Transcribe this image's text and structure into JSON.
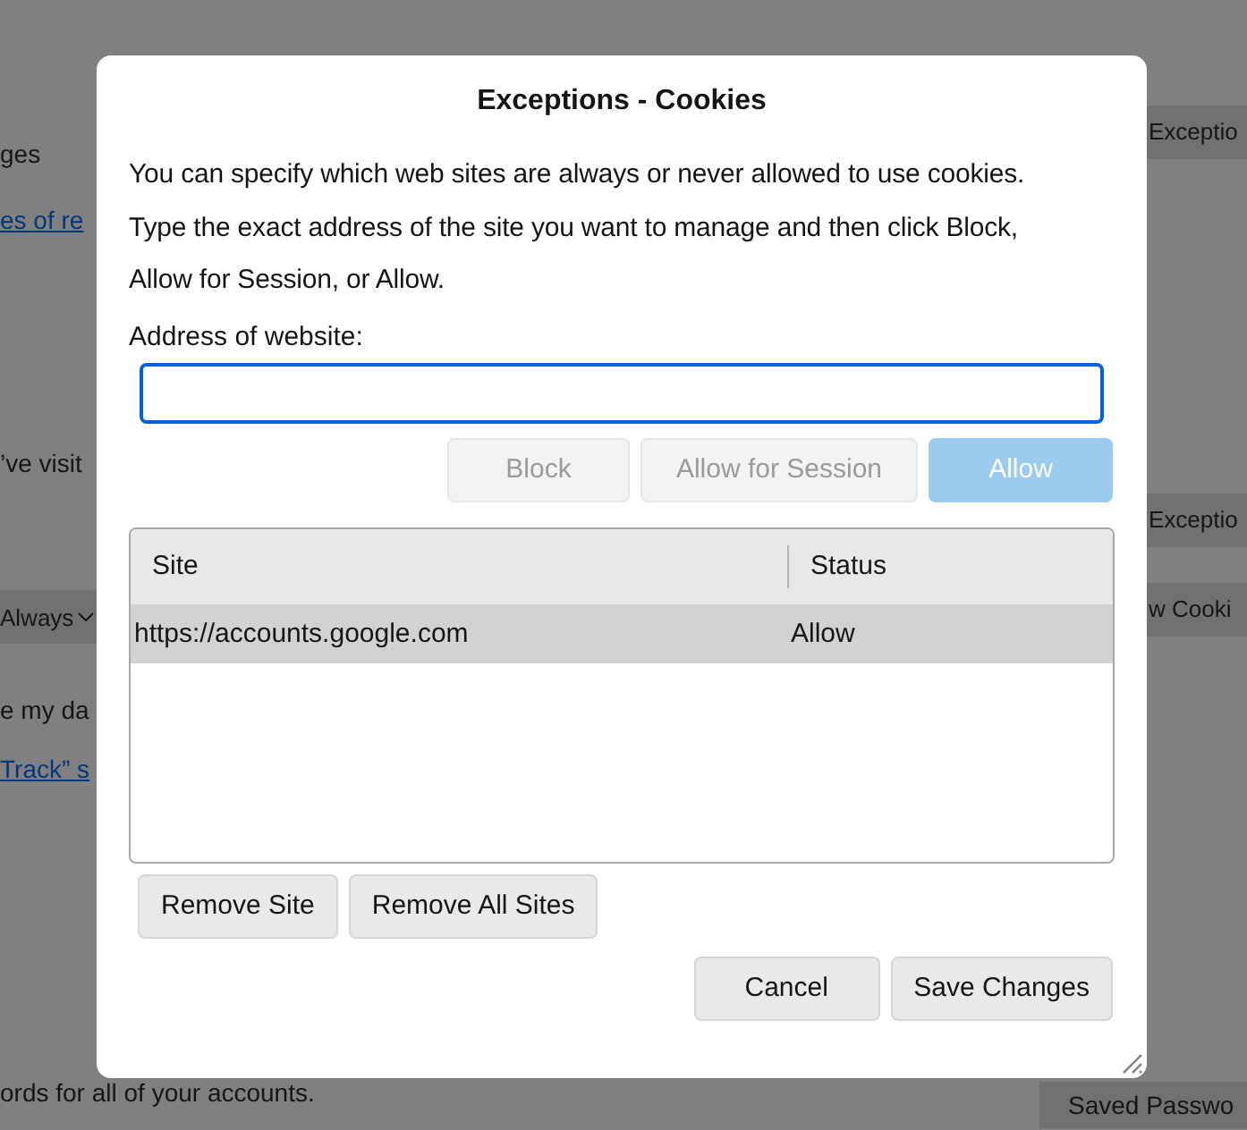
{
  "background_page": {
    "left": [
      {
        "kind": "text",
        "text": "ges"
      },
      {
        "kind": "link",
        "text": "es of re"
      },
      {
        "kind": "text",
        "text": "’ve visit"
      },
      {
        "kind": "dropdown",
        "text": "Always"
      },
      {
        "kind": "text",
        "text": "e my da"
      },
      {
        "kind": "link",
        "text": " Track” s"
      },
      {
        "kind": "text",
        "text": "ords for all of your accounts."
      }
    ],
    "right": [
      {
        "text": "Exceptio"
      },
      {
        "text": "Exceptio"
      },
      {
        "text": "w Cooki"
      },
      {
        "text": "Saved Passwo"
      }
    ]
  },
  "dialog": {
    "title": "Exceptions - Cookies",
    "description": [
      "You can specify which web sites are always or never allowed to use cookies.",
      "Type the exact address of the site you want to manage and then click Block,",
      "Allow for Session, or Allow."
    ],
    "address_label": "Address of website:",
    "action_buttons": [
      {
        "label": "Block",
        "kind": "plain",
        "disabled": true
      },
      {
        "label": "Allow for Session",
        "kind": "plain",
        "disabled": true
      },
      {
        "label": "Allow",
        "kind": "primary",
        "disabled": true
      }
    ],
    "table": {
      "columns": [
        "Site",
        "Status"
      ],
      "rows": [
        {
          "site": "https://accounts.google.com",
          "status": "Allow",
          "selected": true
        }
      ]
    },
    "list_buttons": [
      {
        "label": "Remove Site",
        "disabled": false
      },
      {
        "label": "Remove All Sites",
        "disabled": false
      }
    ],
    "footer_buttons": [
      {
        "label": "Cancel",
        "disabled": false
      },
      {
        "label": "Save Changes",
        "disabled": false
      }
    ]
  }
}
